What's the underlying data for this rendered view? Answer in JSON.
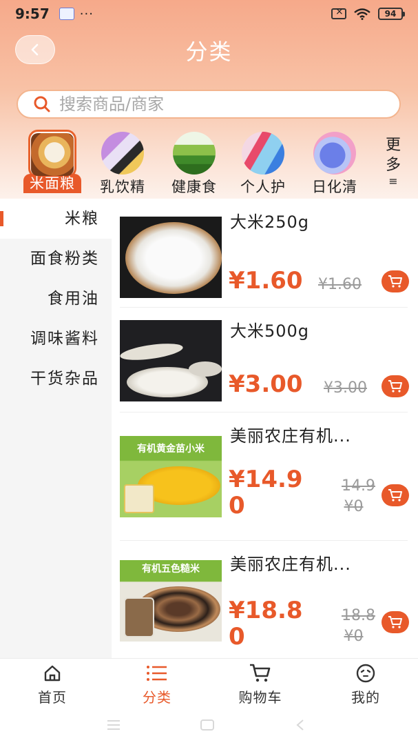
{
  "status_bar": {
    "time": "9:57",
    "dots": "···",
    "battery": "94"
  },
  "header": {
    "title": "分类"
  },
  "search": {
    "placeholder": "搜索商品/商家"
  },
  "categories": [
    {
      "label": "米面粮",
      "active": true
    },
    {
      "label": "乳饮精"
    },
    {
      "label": "健康食"
    },
    {
      "label": "个人护"
    },
    {
      "label": "日化清"
    }
  ],
  "more": {
    "line1": "更",
    "line2": "多",
    "icon": "≡"
  },
  "sidebar": {
    "items": [
      {
        "label": "米粮",
        "active": true
      },
      {
        "label": "面食粉类"
      },
      {
        "label": "食用油"
      },
      {
        "label": "调味酱料"
      },
      {
        "label": "干货杂品"
      }
    ]
  },
  "products": [
    {
      "name": "大米250g",
      "price": "¥1.60",
      "old_price": "¥1.60",
      "image": "white-rice-bowl"
    },
    {
      "name": "大米500g",
      "price": "¥3.00",
      "old_price": "¥3.00",
      "image": "rice-scoops"
    },
    {
      "name": "美丽农庄有机...",
      "price_line1": "¥14.9",
      "price_line2": "0",
      "old_line1": "14.9",
      "old_line2": "¥0",
      "image": "millet-package",
      "image_text": "有机黄金苗小米"
    },
    {
      "name": "美丽农庄有机...",
      "price_line1": "¥18.8",
      "price_line2": "0",
      "old_line1": "18.8",
      "old_line2": "¥0",
      "image": "mixed-grains-jar",
      "image_text": "有机五色糙米"
    }
  ],
  "bottom_nav": [
    {
      "label": "首页",
      "icon": "home-icon"
    },
    {
      "label": "分类",
      "icon": "list-icon",
      "active": true
    },
    {
      "label": "购物车",
      "icon": "cart-icon"
    },
    {
      "label": "我的",
      "icon": "face-icon"
    }
  ],
  "colors": {
    "accent": "#e8592a",
    "header_top": "#f6a98a",
    "strike": "#9a9a9a"
  }
}
